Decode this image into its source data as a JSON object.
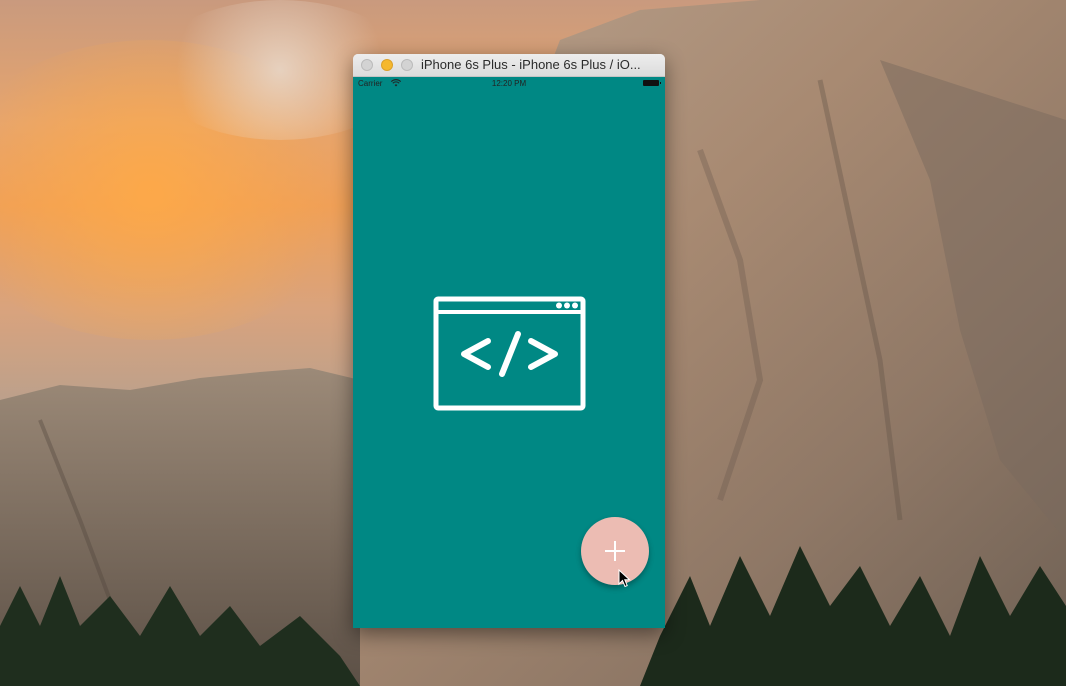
{
  "window": {
    "title": "iPhone 6s Plus - iPhone 6s Plus / iO..."
  },
  "status_bar": {
    "carrier": "Carrier",
    "time": "12:20 PM",
    "wifi_icon": "wifi-icon",
    "battery_icon": "battery-icon"
  },
  "screen": {
    "background_color": "#008884",
    "center_icon": "code-window-icon"
  },
  "fab": {
    "icon": "plus-icon",
    "color": "#ecbcb3"
  },
  "colors": {
    "screen": "#008884",
    "fab": "#ecbcb3",
    "traffic_min": "#f5b82e"
  }
}
